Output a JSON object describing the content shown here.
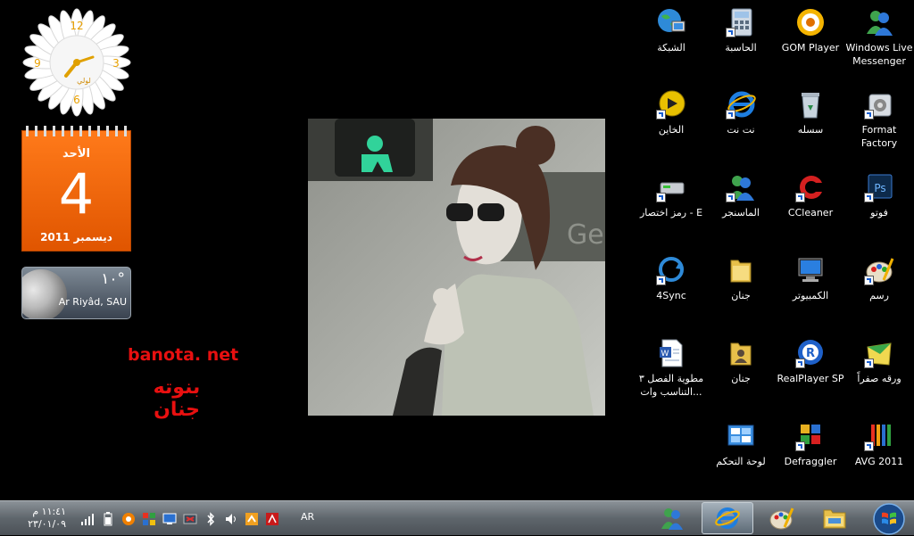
{
  "gadgets": {
    "clock": {
      "numerals": [
        "12",
        "3",
        "6",
        "9"
      ],
      "brand": "ﻟﻮﻟﻲ"
    },
    "calendar": {
      "weekday": "الأحد",
      "day": "4",
      "month_year": "ديسمبر 2011"
    },
    "weather": {
      "temperature": "١٠°",
      "location": "Ar Riyâd, SAU"
    }
  },
  "watermark": {
    "site": "banota. net",
    "name": "بنوته جنان"
  },
  "desktop_icons": [
    {
      "label": "Windows Live Messenger",
      "icon": "messenger-icon"
    },
    {
      "label": "GOM Player",
      "icon": "gom-player-icon"
    },
    {
      "label": "الحاسبة",
      "icon": "calculator-icon"
    },
    {
      "label": "الشبكة",
      "icon": "network-icon"
    },
    {
      "label": "Format Factory",
      "icon": "format-factory-icon"
    },
    {
      "label": "سسله",
      "icon": "recycle-bin-icon"
    },
    {
      "label": "نت نت",
      "icon": "internet-explorer-icon"
    },
    {
      "label": "الخاين",
      "icon": "media-shortcut-icon"
    },
    {
      "label": "فوتو",
      "icon": "photoshop-icon"
    },
    {
      "label": "CCleaner",
      "icon": "ccleaner-icon"
    },
    {
      "label": "الماسنجر",
      "icon": "messenger-shortcut-icon"
    },
    {
      "label": "رمز اختصار - E",
      "icon": "drive-shortcut-icon"
    },
    {
      "label": "رسم",
      "icon": "paint-icon"
    },
    {
      "label": "الكمبيوتر",
      "icon": "computer-icon"
    },
    {
      "label": "جنان",
      "icon": "folder-icon"
    },
    {
      "label": "4Sync",
      "icon": "4sync-icon"
    },
    {
      "label": "ورقه صفراً",
      "icon": "yellow-paper-icon"
    },
    {
      "label": "RealPlayer SP",
      "icon": "realplayer-icon"
    },
    {
      "label": "جنان",
      "icon": "user-folder-icon"
    },
    {
      "label": "مطوية الفصل ٣ التناسب وات...",
      "icon": "word-document-icon"
    },
    {
      "label": "AVG 2011",
      "icon": "avg-icon"
    },
    {
      "label": "Defraggler",
      "icon": "defraggler-icon"
    },
    {
      "label": "لوحة التحكم",
      "icon": "control-panel-icon"
    }
  ],
  "taskbar": {
    "time": "١١:٤١ م",
    "date": "٢٣/٠١/٠٩",
    "language": "AR",
    "pinned": [
      "messenger-icon",
      "internet-explorer-icon",
      "paint-icon",
      "explorer-icon"
    ]
  }
}
